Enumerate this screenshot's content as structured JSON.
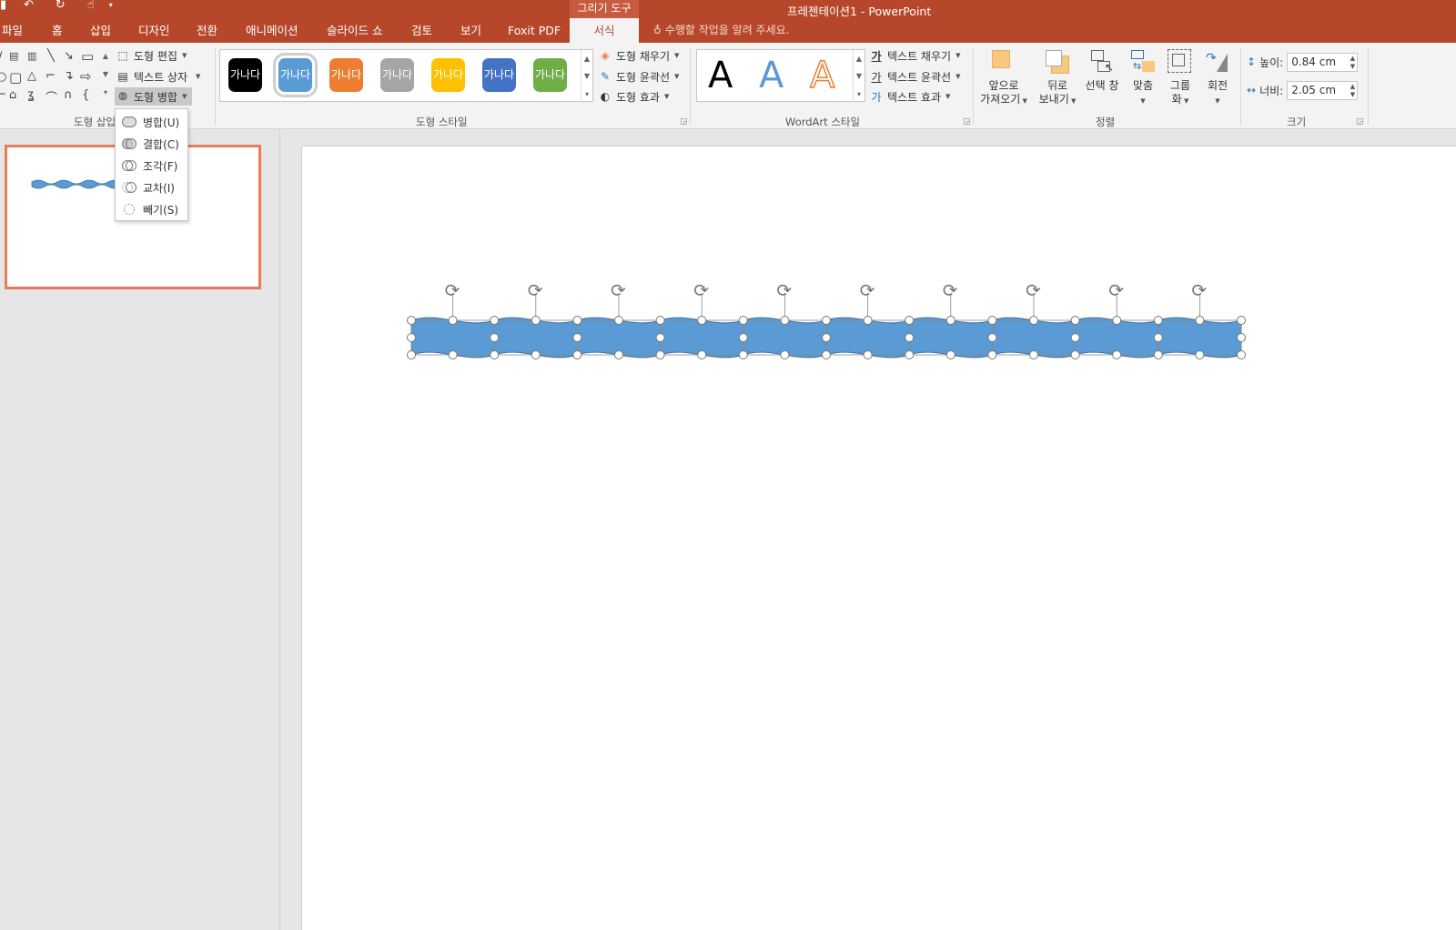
{
  "window": {
    "title": "프레젠테이션1 - PowerPoint",
    "context_tab_group": "그리기 도구"
  },
  "tabs": [
    {
      "label": "파일"
    },
    {
      "label": "홈"
    },
    {
      "label": "삽입"
    },
    {
      "label": "디자인"
    },
    {
      "label": "전환"
    },
    {
      "label": "애니메이션"
    },
    {
      "label": "슬라이드 쇼"
    },
    {
      "label": "검토"
    },
    {
      "label": "보기"
    },
    {
      "label": "Foxit PDF"
    },
    {
      "label": "서식",
      "active": true
    }
  ],
  "tell_me": "수행할 작업을 알려 주세요.",
  "ribbon": {
    "insert_shapes": {
      "label": "도형 삽입",
      "edit_shape": "도형 편집",
      "text_box": "텍스트 상자",
      "merge_shapes": "도형 병합"
    },
    "shape_styles": {
      "label": "도형 스타일",
      "swatches": [
        {
          "text": "가나다",
          "color": "#000000"
        },
        {
          "text": "가나다",
          "color": "#5b9bd5",
          "selected": true
        },
        {
          "text": "가나다",
          "color": "#ed7d31"
        },
        {
          "text": "가나다",
          "color": "#a5a5a5"
        },
        {
          "text": "가나다",
          "color": "#ffc000"
        },
        {
          "text": "가나다",
          "color": "#4472c4"
        },
        {
          "text": "가나다",
          "color": "#70ad47"
        }
      ],
      "fill": "도형 채우기",
      "outline": "도형 윤곽선",
      "effects": "도형 효과"
    },
    "wordart_styles": {
      "label": "WordArt 스타일",
      "samples": [
        "A",
        "A",
        "A"
      ],
      "text_fill": "텍스트 채우기",
      "text_outline": "텍스트 윤곽선",
      "text_effects": "텍스트 효과"
    },
    "arrange": {
      "label": "정렬",
      "bring_forward": [
        "앞으로",
        "가져오기"
      ],
      "send_backward": [
        "뒤로",
        "보내기"
      ],
      "selection_pane": "선택 창",
      "align": "맞춤",
      "group": [
        "그룹",
        "화"
      ],
      "rotate": "회전"
    },
    "size": {
      "label": "크기",
      "height_label": "높이:",
      "height_value": "0.84 cm",
      "width_label": "너비:",
      "width_value": "2.05 cm"
    }
  },
  "merge_menu": {
    "items": [
      {
        "label": "병합(U)",
        "icon": "union-icon"
      },
      {
        "label": "결합(C)",
        "icon": "combine-icon"
      },
      {
        "label": "조각(F)",
        "icon": "fragment-icon"
      },
      {
        "label": "교차(I)",
        "icon": "intersect-icon"
      },
      {
        "label": "빼기(S)",
        "icon": "subtract-icon"
      }
    ]
  },
  "colors": {
    "accent": "#b7472a",
    "shape_fill": "#5b9bd5",
    "shape_outline": "#41719c",
    "thumbnail_border": "#e97a5c"
  }
}
